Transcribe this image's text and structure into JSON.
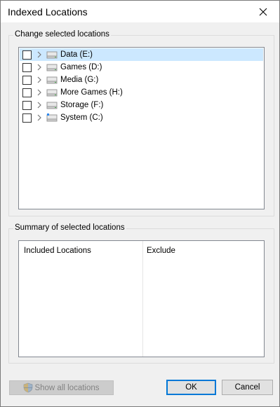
{
  "window": {
    "title": "Indexed Locations"
  },
  "change_group": {
    "label": "Change selected locations",
    "items": [
      {
        "label": "Data (E:)",
        "checked": false,
        "selected": true
      },
      {
        "label": "Games (D:)",
        "checked": false,
        "selected": false
      },
      {
        "label": "Media (G:)",
        "checked": false,
        "selected": false
      },
      {
        "label": "More Games (H:)",
        "checked": false,
        "selected": false
      },
      {
        "label": "Storage (F:)",
        "checked": false,
        "selected": false
      },
      {
        "label": "System (C:)",
        "checked": false,
        "selected": false
      }
    ]
  },
  "summary_group": {
    "label": "Summary of selected locations",
    "columns": [
      "Included Locations",
      "Exclude"
    ]
  },
  "buttons": {
    "show_all": "Show all locations",
    "ok": "OK",
    "cancel": "Cancel"
  },
  "icons": {
    "close": "close-icon",
    "expand": "chevron-right-icon",
    "drive": "drive-icon",
    "shield": "uac-shield-icon"
  },
  "colors": {
    "selection": "#cce8ff",
    "default_button_border": "#0078d7",
    "disabled_text": "#838383"
  }
}
